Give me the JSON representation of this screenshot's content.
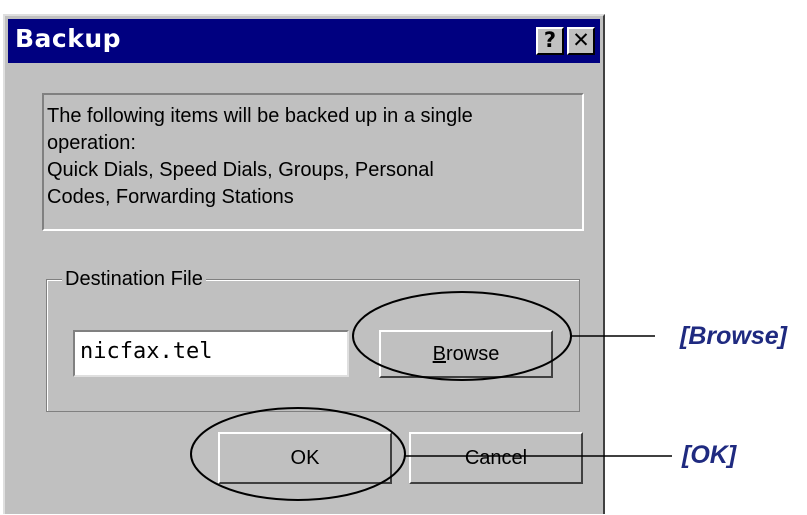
{
  "dialog": {
    "title": "Backup",
    "help_button": "?",
    "close_button": "✕",
    "info_lines": [
      " The following items will be backed up in a single",
      "operation:",
      " Quick Dials, Speed Dials, Groups, Personal",
      "Codes, Forwarding Stations"
    ],
    "destination_group_label": "Destination File",
    "destination_value": "nicfax.tel",
    "browse_button": {
      "accel": "B",
      "rest": "rowse"
    },
    "ok_button": "OK",
    "cancel_button": "Cancel"
  },
  "callouts": {
    "browse": "[Browse]",
    "ok": "[OK]"
  },
  "colors": {
    "titlebar": "#000080",
    "dialog_face": "#c0c0c0",
    "callout_text": "#1f2a80"
  }
}
